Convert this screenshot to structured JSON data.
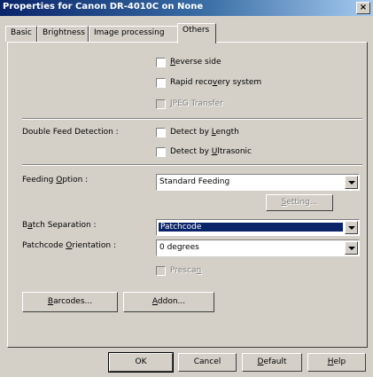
{
  "window": {
    "title": "Properties for Canon DR-4010C on None",
    "close_glyph": "×"
  },
  "tabs": [
    {
      "label": "Basic"
    },
    {
      "label": "Brightness"
    },
    {
      "label": "Image processing"
    },
    {
      "label": "Others",
      "active": true
    }
  ],
  "options": {
    "reverse_side": {
      "pre": "",
      "u": "R",
      "post": "everse side",
      "checked": false,
      "enabled": true
    },
    "rapid_recovery": {
      "pre": "Rapid reco",
      "u": "v",
      "post": "ery system",
      "checked": false,
      "enabled": true
    },
    "jpeg_transfer": {
      "pre": "",
      "u": "J",
      "post": "PEG Transfer",
      "checked": false,
      "enabled": false
    }
  },
  "double_feed": {
    "label": "Double Feed Detection :",
    "by_length": {
      "pre": "Detect by ",
      "u": "L",
      "post": "ength",
      "checked": false
    },
    "by_ultrasonic": {
      "pre": "Detect by ",
      "u": "U",
      "post": "ltrasonic",
      "checked": false
    }
  },
  "feeding": {
    "label_pre": "Feeding ",
    "label_u": "O",
    "label_post": "ption :",
    "value": "Standard Feeding",
    "setting_button_pre": "",
    "setting_button_u": "S",
    "setting_button_post": "etting..."
  },
  "batch": {
    "label_pre": "B",
    "label_u": "a",
    "label_post": "tch Separation :",
    "value": "Patchcode"
  },
  "patchcode": {
    "label_pre": "Patchcode ",
    "label_u": "O",
    "label_post": "rientation :",
    "value": "0 degrees"
  },
  "prescan": {
    "pre": "Presca",
    "u": "n",
    "post": "",
    "checked": false,
    "enabled": false
  },
  "buttons": {
    "barcodes": {
      "pre": "",
      "u": "B",
      "post": "arcodes..."
    },
    "addon": {
      "pre": "",
      "u": "A",
      "post": "ddon..."
    }
  },
  "footer": {
    "ok": "OK",
    "cancel": "Cancel",
    "default": {
      "pre": "",
      "u": "D",
      "post": "efault"
    },
    "help": {
      "pre": "",
      "u": "H",
      "post": "elp"
    }
  },
  "colors": {
    "titlebar": "#0a246a",
    "face": "#d4d0c8",
    "highlight": "#0a246a"
  }
}
